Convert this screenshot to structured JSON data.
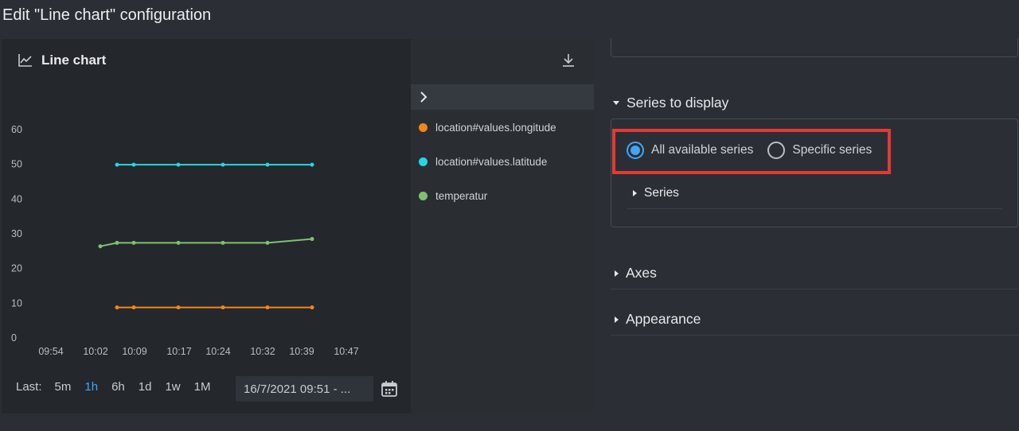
{
  "dialog": {
    "title": "Edit \"Line chart\" configuration"
  },
  "chart_panel": {
    "title": "Line chart",
    "icon": "line-chart-icon"
  },
  "chart_data": {
    "type": "line",
    "title": "",
    "xlabel": "",
    "ylabel": "",
    "x": [
      "09:54",
      "10:02",
      "10:09",
      "10:17",
      "10:24",
      "10:32",
      "10:39",
      "10:47"
    ],
    "x_ticks": [
      "09:54",
      "10:02",
      "10:09",
      "10:17",
      "10:24",
      "10:32",
      "10:39",
      "10:47"
    ],
    "y_ticks": [
      0,
      10,
      20,
      30,
      40,
      50,
      60
    ],
    "ylim": [
      0,
      60
    ],
    "xlim_minutes_from_0954": [
      0,
      58
    ],
    "grid": false,
    "legend": "right",
    "series": [
      {
        "name": "location#values.longitude",
        "color": "#f0861c",
        "points": [
          [
            "10:06",
            8.8
          ],
          [
            "10:09",
            8.8
          ],
          [
            "10:17",
            8.8
          ],
          [
            "10:25",
            8.8
          ],
          [
            "10:33",
            8.8
          ],
          [
            "10:41",
            8.8
          ]
        ]
      },
      {
        "name": "location#values.latitude",
        "color": "#26d7e3",
        "points": [
          [
            "10:06",
            49.9
          ],
          [
            "10:09",
            49.9
          ],
          [
            "10:17",
            49.9
          ],
          [
            "10:25",
            49.9
          ],
          [
            "10:33",
            49.9
          ],
          [
            "10:41",
            49.9
          ]
        ]
      },
      {
        "name": "temperatur",
        "color": "#80c071",
        "points": [
          [
            "10:03",
            26.4
          ],
          [
            "10:06",
            27.4
          ],
          [
            "10:09",
            27.4
          ],
          [
            "10:17",
            27.4
          ],
          [
            "10:25",
            27.4
          ],
          [
            "10:33",
            27.4
          ],
          [
            "10:41",
            28.5
          ]
        ]
      }
    ]
  },
  "legend": {
    "items": [
      {
        "label": "location#values.longitude",
        "color": "#f0861c"
      },
      {
        "label": "location#values.latitude",
        "color": "#26d7e3"
      },
      {
        "label": "temperatur",
        "color": "#80c071"
      }
    ]
  },
  "time_range": {
    "label": "Last:",
    "options": [
      "5m",
      "1h",
      "6h",
      "1d",
      "1w",
      "1M"
    ],
    "active": "1h",
    "date_value": "16/7/2021 09:51 - ..."
  },
  "config": {
    "series_section": "Series to display",
    "radio_all": "All available series",
    "radio_specific": "Specific series",
    "selected": "all",
    "series_subsection": "Series",
    "axes_section": "Axes",
    "appearance_section": "Appearance"
  },
  "colors": {
    "accent": "#42a5f5",
    "highlight": "#e53935",
    "panel": "#24272c",
    "background": "#2b2f35"
  }
}
